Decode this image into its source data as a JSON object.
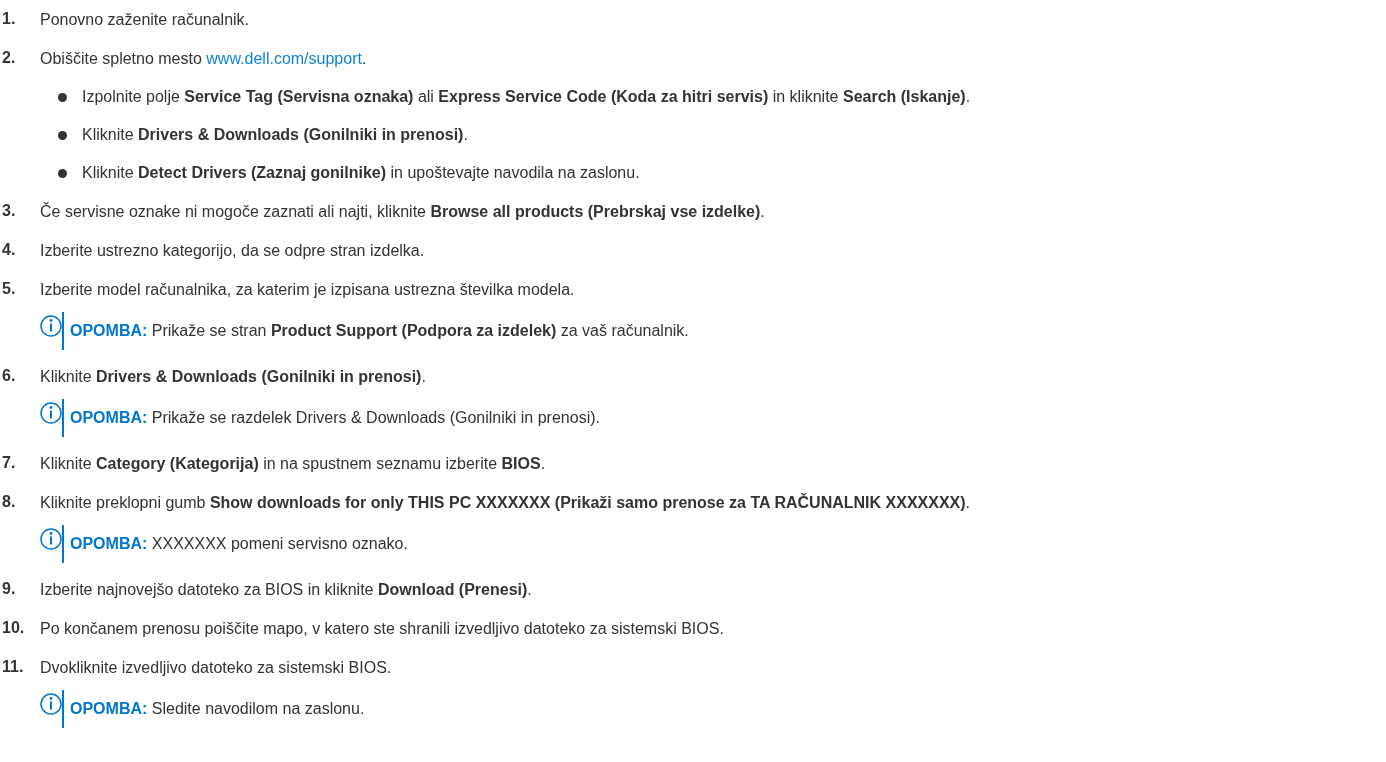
{
  "steps": [
    {
      "number": "1.",
      "segments": [
        {
          "kind": "text",
          "text": "Ponovno zaženite računalnik."
        }
      ]
    },
    {
      "number": "2.",
      "segments": [
        {
          "kind": "text",
          "text": "Obiščite spletno mesto "
        },
        {
          "kind": "link",
          "text": "www.dell.com/support"
        },
        {
          "kind": "text",
          "text": "."
        }
      ],
      "bullets": [
        "Izpolnite polje **Service Tag (Servisna oznaka)** ali **Express Service Code (Koda za hitri servis)** in kliknite **Search (Iskanje)**.",
        "Kliknite **Drivers & Downloads (Gonilniki in prenosi)**.",
        "Kliknite **Detect Drivers (Zaznaj gonilnike)** in upoštevajte navodila na zaslonu."
      ]
    },
    {
      "number": "3.",
      "segments": [
        {
          "kind": "text",
          "text": "Če servisne oznake ni mogoče zaznati ali najti, kliknite **Browse all products (Prebrskaj vse izdelke)**."
        }
      ]
    },
    {
      "number": "4.",
      "segments": [
        {
          "kind": "text",
          "text": "Izberite ustrezno kategorijo, da se odpre stran izdelka."
        }
      ]
    },
    {
      "number": "5.",
      "segments": [
        {
          "kind": "text",
          "text": "Izberite model računalnika, za katerim je izpisana ustrezna številka modela."
        }
      ],
      "note": {
        "label": "OPOMBA:",
        "text": "Prikaže se stran **Product Support (Podpora za izdelek)** za vaš računalnik."
      }
    },
    {
      "number": "6.",
      "segments": [
        {
          "kind": "text",
          "text": "Kliknite **Drivers & Downloads (Gonilniki in prenosi)**."
        }
      ],
      "note": {
        "label": "OPOMBA:",
        "text": "Prikaže se razdelek Drivers & Downloads (Gonilniki in prenosi)."
      }
    },
    {
      "number": "7.",
      "segments": [
        {
          "kind": "text",
          "text": "Kliknite **Category (Kategorija)** in na spustnem seznamu izberite **BIOS**."
        }
      ]
    },
    {
      "number": "8.",
      "segments": [
        {
          "kind": "text",
          "text": "Kliknite preklopni gumb **Show downloads for only THIS PC XXXXXXX (Prikaži samo prenose za TA RAČUNALNIK XXXXXXX)**."
        }
      ],
      "note": {
        "label": "OPOMBA:",
        "text": "XXXXXXX pomeni servisno oznako."
      }
    },
    {
      "number": "9.",
      "segments": [
        {
          "kind": "text",
          "text": "Izberite najnovejšo datoteko za BIOS in kliknite **Download (Prenesi)**."
        }
      ]
    },
    {
      "number": "10.",
      "segments": [
        {
          "kind": "text",
          "text": "Po končanem prenosu poiščite mapo, v katero ste shranili izvedljivo datoteko za sistemski BIOS."
        }
      ]
    },
    {
      "number": "11.",
      "segments": [
        {
          "kind": "text",
          "text": "Dvokliknite izvedljivo datoteko za sistemski BIOS."
        }
      ],
      "note": {
        "label": "OPOMBA:",
        "text": "Sledite navodilom na zaslonu."
      }
    }
  ]
}
